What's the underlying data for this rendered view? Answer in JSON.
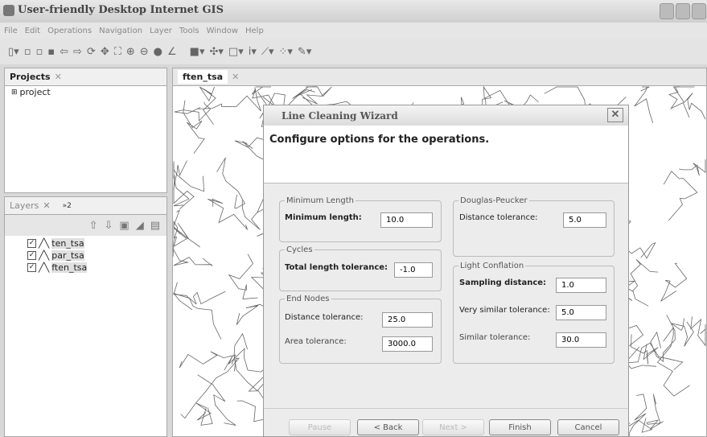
{
  "window": {
    "title": "User-friendly Desktop Internet GIS"
  },
  "menu": [
    "File",
    "Edit",
    "Operations",
    "Navigation",
    "Layer",
    "Tools",
    "Window",
    "Help"
  ],
  "projects": {
    "tab": "Projects",
    "items": [
      "project"
    ]
  },
  "layers": {
    "tab": "Layers",
    "tab2": "»2",
    "items": [
      "ten_tsa",
      "par_tsa",
      "ften_tsa"
    ]
  },
  "editor": {
    "tab": "ften_tsa"
  },
  "dialog": {
    "title": "Line Cleaning Wizard",
    "heading": "Configure options for the operations.",
    "groups": {
      "min_length": {
        "legend": "Minimum Length",
        "label": "Minimum length:",
        "value": "10.0"
      },
      "cycles": {
        "legend": "Cycles",
        "label": "Total length tolerance:",
        "value": "-1.0"
      },
      "end_nodes": {
        "legend": "End Nodes",
        "dist_label": "Distance tolerance:",
        "dist_value": "25.0",
        "area_label": "Area tolerance:",
        "area_value": "3000.0"
      },
      "douglas": {
        "legend": "Douglas-Peucker",
        "label": "Distance tolerance:",
        "value": "5.0"
      },
      "light": {
        "legend": "Light Conflation",
        "sampling_label": "Sampling distance:",
        "sampling_value": "1.0",
        "very_label": "Very similar tolerance:",
        "very_value": "5.0",
        "similar_label": "Similar tolerance:",
        "similar_value": "30.0"
      }
    },
    "buttons": {
      "pause": "Pause",
      "back": "< Back",
      "next": "Next >",
      "finish": "Finish",
      "cancel": "Cancel"
    }
  }
}
